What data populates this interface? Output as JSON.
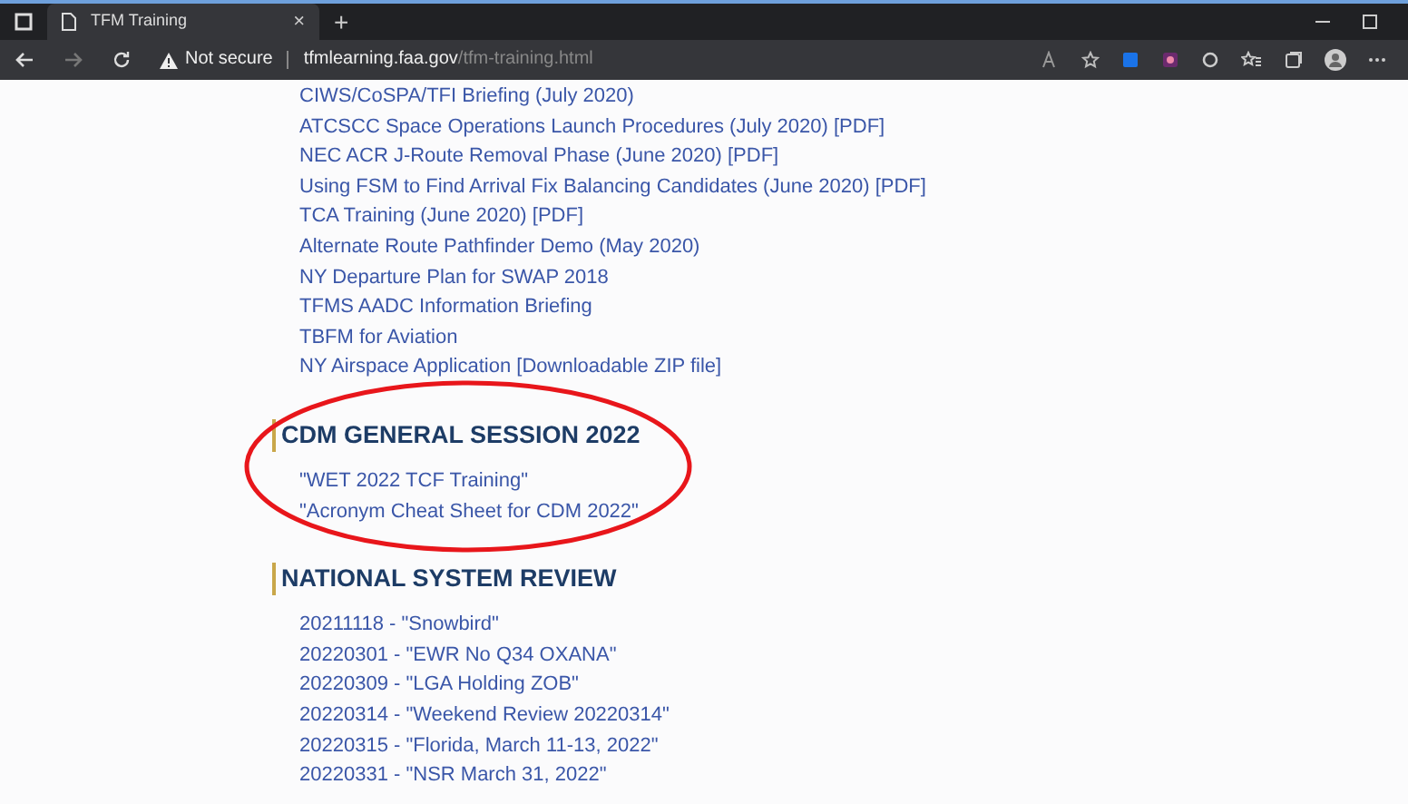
{
  "browser": {
    "tab": {
      "title": "TFM Training",
      "close": "×",
      "selected": true
    },
    "new_tab": "+",
    "address": {
      "security": "Not secure",
      "host": "tfmlearning.faa.gov",
      "path": "/tfm-training.html"
    }
  },
  "links": [
    "CIWS/CoSPA/TFI Briefing (July 2020)",
    "ATCSCC Space Operations Launch Procedures (July 2020) [PDF]",
    "NEC ACR J-Route Removal Phase (June 2020) [PDF]",
    "Using FSM to Find Arrival Fix Balancing Candidates (June 2020) [PDF]",
    "TCA Training (June 2020) [PDF]",
    "Alternate Route Pathfinder Demo (May 2020)",
    "NY Departure Plan for SWAP 2018",
    "TFMS AADC Information Briefing",
    "TBFM for Aviation",
    "NY Airspace Application [Downloadable ZIP file]"
  ],
  "sections": [
    {
      "heading": "CDM GENERAL SESSION 2022",
      "items": [
        "\"WET 2022 TCF Training\"",
        "\"Acronym Cheat Sheet for CDM 2022\""
      ]
    },
    {
      "heading": "NATIONAL SYSTEM REVIEW",
      "items": [
        "20211118 - \"Snowbird\"",
        "20220301 - \"EWR No Q34 OXANA\"",
        "20220309 - \"LGA Holding ZOB\"",
        "20220314 - \"Weekend Review 20220314\"",
        "20220315 - \"Florida, March 11-13, 2022\"",
        "20220331 - \"NSR March 31, 2022\""
      ]
    }
  ],
  "annotation": {
    "kind": "ellipse"
  }
}
